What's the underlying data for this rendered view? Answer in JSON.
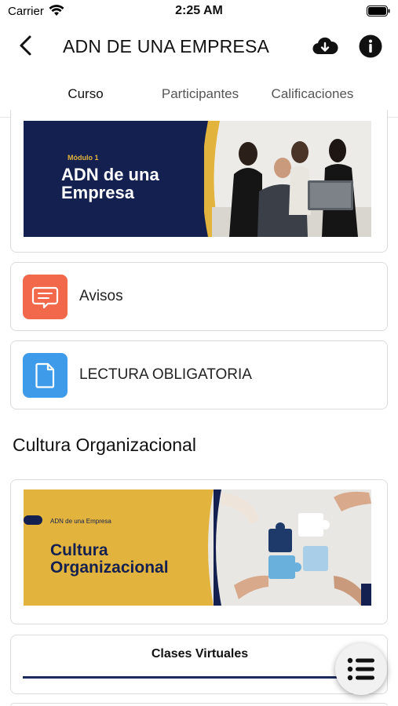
{
  "status_bar": {
    "carrier": "Carrier",
    "time": "2:25 AM"
  },
  "nav": {
    "title": "ADN DE UNA EMPRESA"
  },
  "tabs": [
    {
      "label": "Curso",
      "active": true
    },
    {
      "label": "Participantes",
      "active": false
    },
    {
      "label": "Calificaciones",
      "active": false
    }
  ],
  "banner_1": {
    "module_tag": "Módulo 1",
    "title_line_1": "ADN de una",
    "title_line_2": "Empresa"
  },
  "items": [
    {
      "label": "Avisos",
      "icon": "chat-bubble-icon",
      "color": "#f2684a"
    },
    {
      "label": "LECTURA OBLIGATORIA",
      "icon": "document-icon",
      "color": "#3d9be9"
    }
  ],
  "section": {
    "title": "Cultura Organizacional"
  },
  "banner_2": {
    "tag": "ADN de una Empresa",
    "title_line_1": "Cultura",
    "title_line_2": "Organizacional"
  },
  "clases": {
    "label": "Clases Virtuales"
  },
  "colors": {
    "navy": "#1d2b5c",
    "gold": "#e3b43d",
    "banner_navy": "#142050"
  }
}
